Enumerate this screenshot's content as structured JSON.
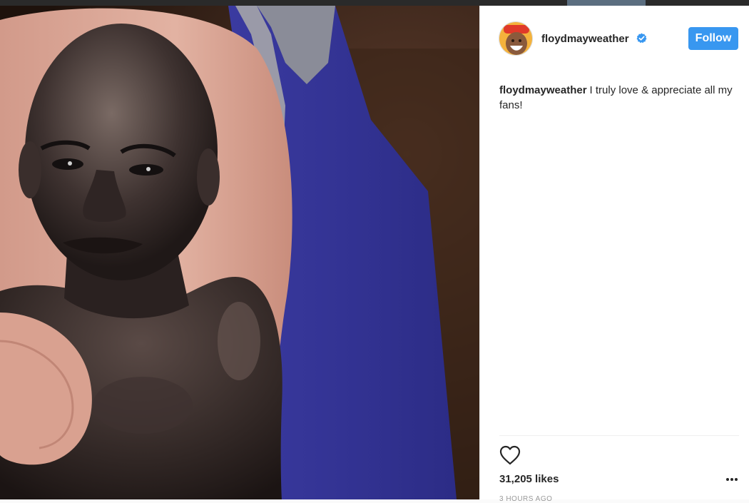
{
  "post": {
    "username": "floydmayweather",
    "follow_label": "Follow",
    "caption_user": "floydmayweather",
    "caption_text": "I truly love & appreciate all my fans!",
    "likes": "31,205 likes",
    "timestamp": "3 HOURS AGO"
  },
  "icons": {
    "verified": "verified-badge-icon",
    "like": "heart-icon",
    "more": "more-options-icon"
  },
  "colors": {
    "follow_button": "#3897f0",
    "verified_badge": "#3897f0",
    "text": "#262626",
    "timestamp": "#999999"
  }
}
